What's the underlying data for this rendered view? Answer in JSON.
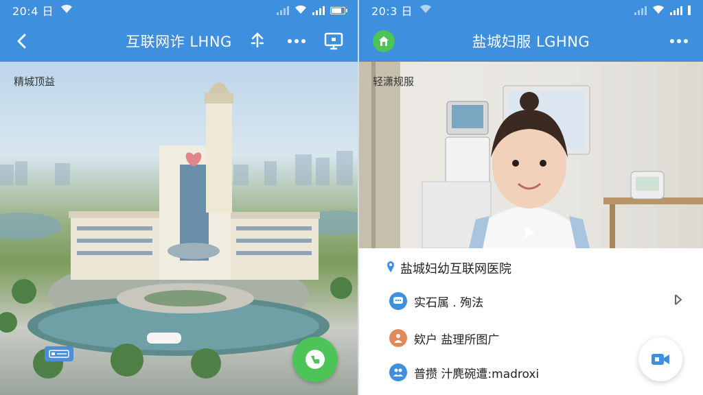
{
  "left": {
    "status_time": "20:4 日",
    "nav_title": "互联网诈 LHNG",
    "photo_caption": "精城顶益"
  },
  "right": {
    "status_time": "20:3 日",
    "nav_title": "盐城妇服 LGHNG",
    "photo_caption": "轻潇规服",
    "hospital_name": "盐城妇幼互联网医院",
    "menu": [
      {
        "label": "实石属 . 殉法",
        "icon": "chat-icon",
        "color": "#3f8fdf"
      },
      {
        "label": "欸户 盐理所图广",
        "icon": "person-icon",
        "color": "#e08a5c"
      },
      {
        "label": "普攒 汁麂碗遭:madroxi",
        "icon": "people-icon",
        "color": "#3f8fdf"
      }
    ]
  },
  "colors": {
    "accent": "#3f8fdf",
    "fab_green": "#4cc457"
  }
}
